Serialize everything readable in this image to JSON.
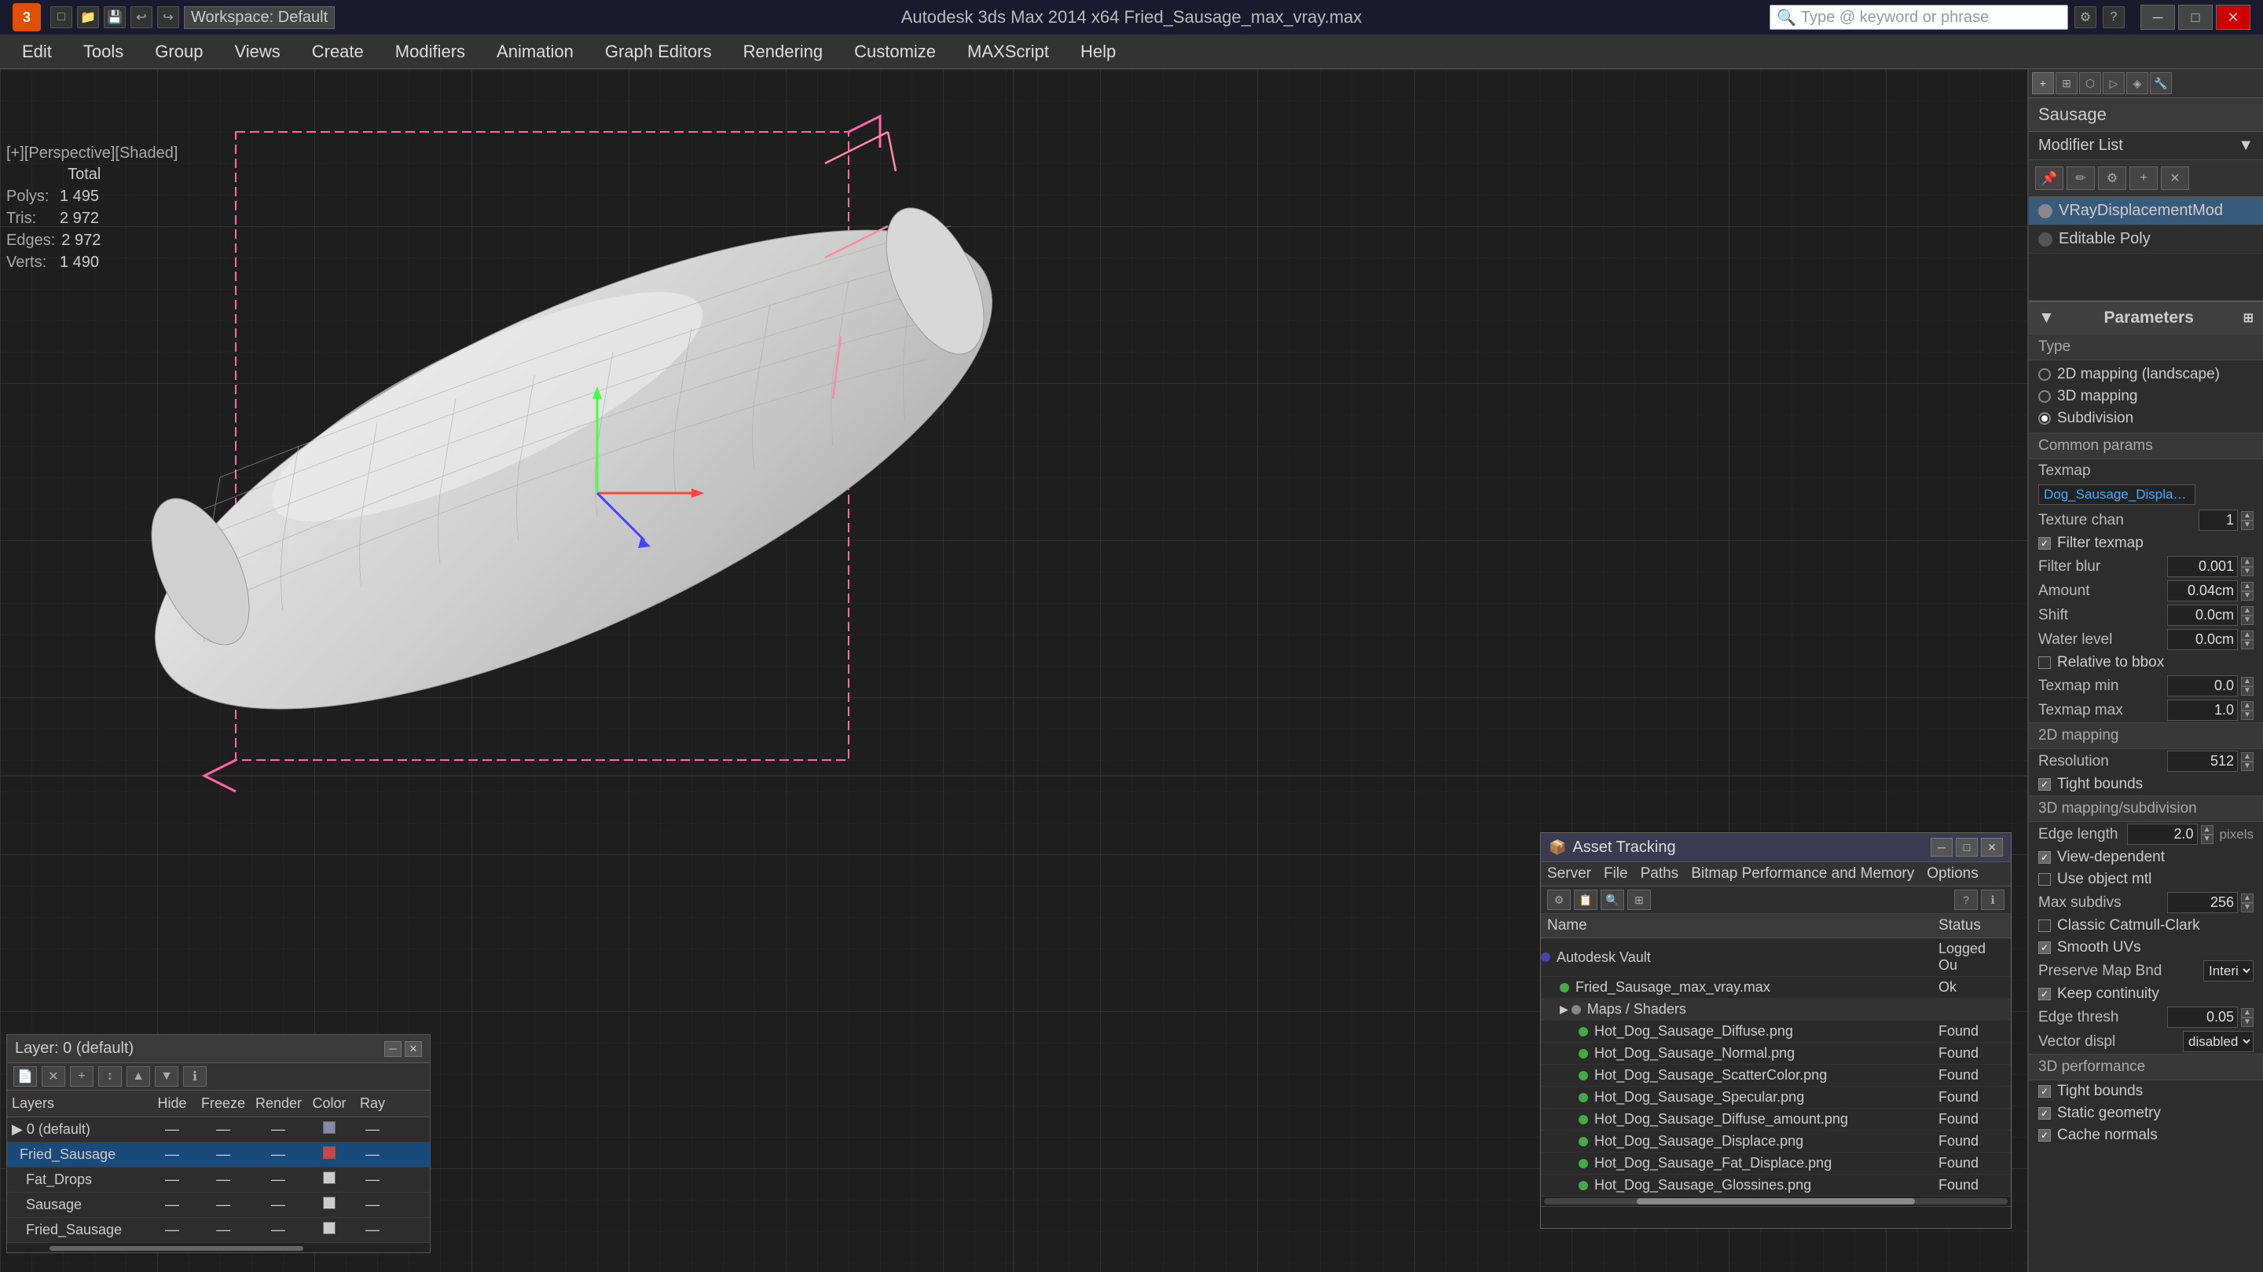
{
  "titlebar": {
    "app_label": "3",
    "title": "Autodesk 3ds Max 2014 x64     Fried_Sausage_max_vray.max",
    "search_placeholder": "Type @ keyword or phrase",
    "workspace": "Workspace: Default",
    "win_minimize": "─",
    "win_maximize": "□",
    "win_close": "✕"
  },
  "menubar": {
    "items": [
      "Edit",
      "Tools",
      "Group",
      "Views",
      "Create",
      "Modifiers",
      "Animation",
      "Graph Editors",
      "Rendering",
      "Customize",
      "MAXScript",
      "Help"
    ]
  },
  "viewport": {
    "label": "[+][Perspective][Shaded]",
    "stats": {
      "polys_label": "Polys:",
      "polys_total": "Total",
      "polys_value": "1 495",
      "tris_label": "Tris:",
      "tris_value": "2 972",
      "edges_label": "Edges:",
      "edges_value": "2 972",
      "verts_label": "Verts:",
      "verts_value": "1 490"
    }
  },
  "right_panel": {
    "object_name": "Sausage",
    "modifier_list_label": "Modifier List",
    "modifiers": [
      {
        "name": "VRayDisplacementMod",
        "active": true
      },
      {
        "name": "Editable Poly",
        "active": false
      }
    ],
    "icon_buttons": [
      "▣",
      "✏",
      "⬡",
      "⊕",
      "◈"
    ]
  },
  "parameters": {
    "title": "Parameters",
    "type_label": "Type",
    "type_options": [
      {
        "label": "2D mapping (landscape)",
        "selected": false
      },
      {
        "label": "3D mapping",
        "selected": false
      },
      {
        "label": "Subdivision",
        "selected": true
      }
    ],
    "common_params_label": "Common params",
    "texmap_label": "Texmap",
    "texmap_name": "Dog_Sausage_Displace.png)",
    "texture_chan_label": "Texture chan",
    "texture_chan_value": "1",
    "filter_texmap_label": "Filter texmap",
    "filter_texmap_checked": true,
    "filter_blur_label": "Filter blur",
    "filter_blur_value": "0.001",
    "amount_label": "Amount",
    "amount_value": "0.04cm",
    "shift_label": "Shift",
    "shift_value": "0.0cm",
    "water_level_label": "Water level",
    "water_level_value": "0.0cm",
    "relative_to_bbox_label": "Relative to bbox",
    "relative_to_bbox_checked": false,
    "texmap_min_label": "Texmap min",
    "texmap_min_value": "0.0",
    "texmap_max_label": "Texmap max",
    "texmap_max_value": "1.0",
    "mapping_2d_label": "2D mapping",
    "resolution_label": "Resolution",
    "resolution_value": "512",
    "tight_bounds_label": "Tight bounds",
    "tight_bounds_checked": true,
    "mapping_3d_label": "3D mapping/subdivision",
    "edge_length_label": "Edge length",
    "edge_length_value": "2.0",
    "edge_length_unit": "pixels",
    "view_dependent_label": "View-dependent",
    "view_dependent_checked": true,
    "use_object_mtl_label": "Use object mtl",
    "use_object_mtl_checked": false,
    "max_subdivs_label": "Max subdivs",
    "max_subdivs_value": "256",
    "classic_catmull_label": "Classic Catmull-Clark",
    "classic_catmull_checked": false,
    "smooth_uvs_label": "Smooth UVs",
    "smooth_uvs_checked": true,
    "preserve_map_bnd_label": "Preserve Map Bnd",
    "preserve_map_bnd_value": "Interi",
    "keep_continuity_label": "Keep continuity",
    "keep_continuity_checked": true,
    "edge_thresh_label": "Edge thresh",
    "edge_thresh_value": "0.05",
    "vector_displ_label": "Vector displ",
    "vector_displ_value": "disabled",
    "performance_label": "3D performance",
    "tight_bounds2_label": "Tight bounds",
    "tight_bounds2_checked": true,
    "static_geometry_label": "Static geometry",
    "static_geometry_checked": true,
    "cache_normals_label": "Cache normals",
    "cache_normals_checked": true
  },
  "layer_panel": {
    "title": "Layer: 0 (default)",
    "columns": [
      "Layers",
      "Hide",
      "Freeze",
      "Render",
      "Color",
      "Ray"
    ],
    "rows": [
      {
        "name": "0 (default)",
        "active": false,
        "color": "#8888aa"
      },
      {
        "name": "Fried_Sausage",
        "active": true,
        "color": "#cc4444"
      },
      {
        "name": "Fat_Drops",
        "active": false,
        "color": "#cccccc"
      },
      {
        "name": "Sausage",
        "active": false,
        "color": "#cccccc"
      },
      {
        "name": "Fried_Sausage",
        "active": false,
        "color": "#cccccc"
      }
    ]
  },
  "asset_panel": {
    "title": "Asset Tracking",
    "menus": [
      "Server",
      "File",
      "Paths",
      "Bitmap Performance and Memory",
      "Options"
    ],
    "columns": [
      "Name",
      "Status"
    ],
    "rows": [
      {
        "type": "vault",
        "name": "Autodesk Vault",
        "status": "Logged Ou",
        "indent": 0
      },
      {
        "type": "file",
        "name": "Fried_Sausage_max_vray.max",
        "status": "Ok",
        "indent": 1
      },
      {
        "type": "group",
        "name": "Maps / Shaders",
        "status": "",
        "indent": 1
      },
      {
        "type": "image",
        "name": "Hot_Dog_Sausage_Diffuse.png",
        "status": "Found",
        "indent": 2
      },
      {
        "type": "image",
        "name": "Hot_Dog_Sausage_Normal.png",
        "status": "Found",
        "indent": 2
      },
      {
        "type": "image",
        "name": "Hot_Dog_Sausage_ScatterColor.png",
        "status": "Found",
        "indent": 2
      },
      {
        "type": "image",
        "name": "Hot_Dog_Sausage_Specular.png",
        "status": "Found",
        "indent": 2
      },
      {
        "type": "image",
        "name": "Hot_Dog_Sausage_Diffuse_amount.png",
        "status": "Found",
        "indent": 2
      },
      {
        "type": "image",
        "name": "Hot_Dog_Sausage_Displace.png",
        "status": "Found",
        "indent": 2
      },
      {
        "type": "image",
        "name": "Hot_Dog_Sausage_Fat_Displace.png",
        "status": "Found",
        "indent": 2
      },
      {
        "type": "image",
        "name": "Hot_Dog_Sausage_Glossines.png",
        "status": "Found",
        "indent": 2
      }
    ]
  }
}
